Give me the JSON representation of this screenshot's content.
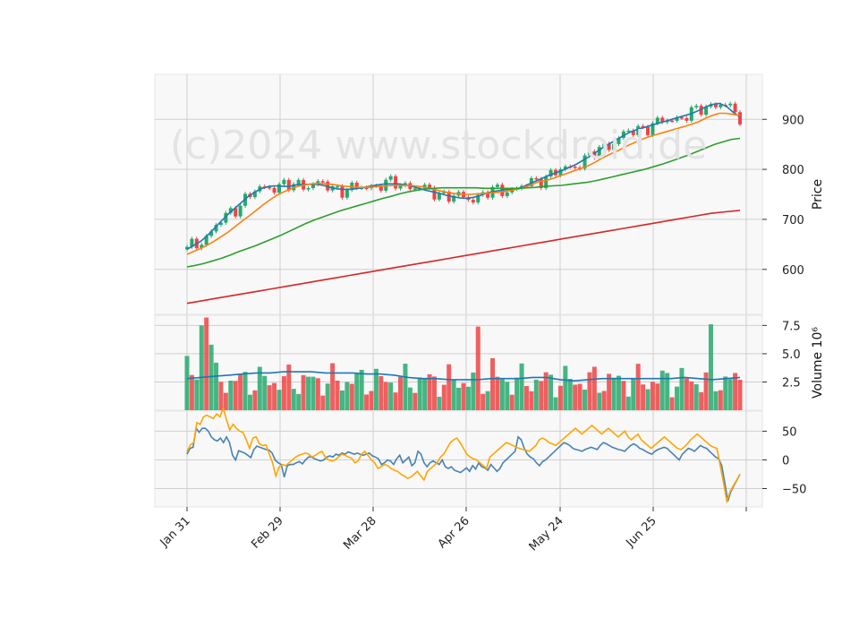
{
  "chart_data": {
    "type": "candlestick",
    "watermark": "(c)2024 www.stockdroid.de",
    "x_ticks": [
      "Jan 31",
      "Feb 29",
      "Mar 28",
      "Apr 26",
      "May 24",
      "Jun 25"
    ],
    "panels": {
      "price": {
        "ylabel": "Price",
        "yticks": [
          600,
          700,
          800,
          900
        ],
        "ylim": [
          510,
          990
        ],
        "series": [
          {
            "color": "#1f77b4",
            "values": [
              640,
              648,
              656,
              668,
              682,
              696,
              710,
              722,
              734,
              746,
              755,
              762,
              766,
              767,
              766,
              766,
              769,
              770,
              770,
              770,
              768,
              764,
              761,
              760,
              760,
              762,
              764,
              767,
              769,
              771,
              771,
              771,
              769,
              766,
              762,
              758,
              755,
              752,
              748,
              745,
              743,
              742,
              744,
              748,
              753,
              756,
              758,
              760,
              760,
              764,
              770,
              776,
              782,
              788,
              793,
              798,
              804,
              810,
              818,
              826,
              835,
              844,
              852,
              860,
              868,
              875,
              880,
              884,
              888,
              892,
              896,
              900,
              904,
              908,
              912,
              918,
              925,
              930,
              932,
              926,
              914,
              905
            ]
          },
          {
            "color": "#ff7f0e",
            "values": [
              630,
              636,
              642,
              649,
              657,
              666,
              675,
              686,
              697,
              707,
              718,
              729,
              739,
              748,
              755,
              761,
              766,
              769,
              771,
              772,
              771,
              770,
              768,
              766,
              765,
              764,
              764,
              765,
              766,
              767,
              768,
              768,
              768,
              767,
              765,
              762,
              759,
              756,
              753,
              751,
              750,
              750,
              751,
              752,
              753,
              754,
              756,
              758,
              761,
              765,
              770,
              776,
              778,
              782,
              787,
              792,
              797,
              802,
              807,
              814,
              822,
              829,
              835,
              842,
              849,
              855,
              861,
              866,
              870,
              874,
              878,
              882,
              886,
              890,
              895,
              902,
              908,
              912,
              912,
              910,
              908
            ]
          },
          {
            "color": "#2ca02c",
            "values": [
              605,
              608,
              612,
              617,
              622,
              628,
              635,
              641,
              647,
              654,
              661,
              668,
              676,
              684,
              692,
              699,
              705,
              711,
              717,
              722,
              727,
              732,
              737,
              742,
              746,
              751,
              755,
              758,
              761,
              762,
              763,
              763,
              763,
              763,
              763,
              762,
              762,
              762,
              762,
              762,
              763,
              764,
              766,
              767,
              768,
              770,
              772,
              774,
              777,
              781,
              785,
              789,
              793,
              797,
              801,
              806,
              811,
              817,
              823,
              829,
              836,
              843,
              850,
              855,
              860,
              862
            ]
          },
          {
            "color": "#d62728",
            "values": [
              532,
              537,
              542,
              547,
              552,
              557,
              562,
              567,
              572,
              577,
              582,
              587,
              592,
              597,
              602,
              607,
              612,
              617,
              622,
              627,
              632,
              637,
              642,
              647,
              652,
              657,
              662,
              667,
              672,
              677,
              682,
              687,
              692,
              697,
              702,
              707,
              712,
              715,
              718
            ]
          }
        ]
      },
      "volume": {
        "ylabel": "Volume  10^6",
        "yticks": [
          "2.5",
          "5.0",
          "7.5"
        ],
        "ylim": [
          0,
          8.4
        ],
        "avg_color": "#1f77b4",
        "avg": [
          2.8,
          2.9,
          3.0,
          3.1,
          3.2,
          3.3,
          3.3,
          3.4,
          3.4,
          3.4,
          3.3,
          3.3,
          3.3,
          3.2,
          3.2,
          3.1,
          2.9,
          2.8,
          2.8,
          2.7,
          2.7,
          2.7,
          2.8,
          2.8,
          2.8,
          2.9,
          2.9,
          2.7,
          2.6,
          2.7,
          2.8,
          2.8,
          2.8,
          2.8,
          2.8,
          2.8,
          2.9,
          2.8,
          2.7,
          2.8,
          2.9
        ]
      },
      "indicator": {
        "yticks": [
          "50",
          "0",
          "−50"
        ],
        "ylim": [
          -82,
          85
        ],
        "series": [
          {
            "color": "#4682b4",
            "values": [
              10,
              20,
              22,
              55,
              48,
              55,
              55,
              50,
              40,
              35,
              33,
              38,
              30,
              40,
              30,
              8,
              0,
              16,
              14,
              12,
              8,
              4,
              18,
              24,
              22,
              20,
              18,
              17,
              12,
              0,
              -5,
              -8,
              -30,
              -10,
              -8,
              -8,
              -5,
              -3,
              -7,
              0,
              5,
              5,
              2,
              0,
              -2,
              0,
              5,
              7,
              5,
              10,
              8,
              12,
              10,
              14,
              12,
              10,
              12,
              10,
              8,
              10,
              12,
              7,
              5,
              2,
              -8,
              -5,
              0,
              -2,
              -8,
              2,
              8,
              -5,
              0,
              5,
              -10,
              -5,
              15,
              10,
              -5,
              -12,
              -5,
              -2,
              -5,
              -8,
              0,
              -12,
              -15,
              -12,
              -18,
              -20,
              -22,
              -18,
              -14,
              -20,
              -10,
              -16,
              -5,
              -12,
              -14,
              -18,
              -8,
              -14,
              -20,
              -15,
              -5,
              0,
              5,
              10,
              15,
              40,
              35,
              20,
              10,
              5,
              2,
              -5,
              -10,
              -3,
              0,
              5,
              10,
              15,
              20,
              25,
              30,
              28,
              25,
              20,
              18,
              17,
              15,
              18,
              20,
              22,
              20,
              18,
              25,
              30,
              28,
              25,
              22,
              20,
              18,
              17,
              15,
              20,
              25,
              28,
              25,
              20,
              18,
              15,
              12,
              10,
              15,
              18,
              20,
              22,
              20,
              15,
              10,
              5,
              0,
              10,
              15,
              20,
              18,
              15,
              20,
              25,
              22,
              20,
              15,
              10,
              5,
              2,
              -10,
              -40,
              -72,
              -55,
              -45,
              -35,
              -25
            ]
          },
          {
            "color": "#ffa500",
            "values": [
              14,
              26,
              30,
              65,
              62,
              75,
              78,
              75,
              72,
              80,
              75,
              90,
              70,
              52,
              62,
              55,
              50,
              48,
              35,
              20,
              38,
              40,
              28,
              25,
              26,
              10,
              -5,
              -28,
              -12,
              -8,
              -10,
              -5,
              0,
              5,
              8,
              10,
              12,
              10,
              5,
              8,
              12,
              15,
              5,
              0,
              -2,
              0,
              5,
              10,
              8,
              5,
              3,
              -5,
              -2,
              10,
              15,
              8,
              0,
              -5,
              -15,
              -12,
              -8,
              -10,
              -15,
              -18,
              -20,
              -25,
              -28,
              -32,
              -30,
              -25,
              -20,
              -28,
              -35,
              -20,
              -15,
              -10,
              -5,
              5,
              10,
              20,
              30,
              35,
              38,
              30,
              20,
              10,
              5,
              2,
              0,
              -5,
              -10,
              -15,
              5,
              10,
              15,
              20,
              25,
              30,
              28,
              25,
              22,
              20,
              18,
              17,
              15,
              20,
              25,
              35,
              38,
              35,
              30,
              28,
              25,
              30,
              35,
              40,
              45,
              50,
              55,
              50,
              45,
              50,
              55,
              60,
              55,
              50,
              45,
              50,
              55,
              50,
              45,
              40,
              45,
              50,
              40,
              35,
              40,
              45,
              35,
              30,
              25,
              20,
              25,
              30,
              35,
              40,
              35,
              30,
              25,
              20,
              18,
              22,
              28,
              35,
              40,
              45,
              40,
              35,
              30,
              25,
              22,
              20,
              -10,
              -40,
              -72,
              -55,
              -45,
              -35,
              -25
            ]
          }
        ]
      }
    }
  }
}
